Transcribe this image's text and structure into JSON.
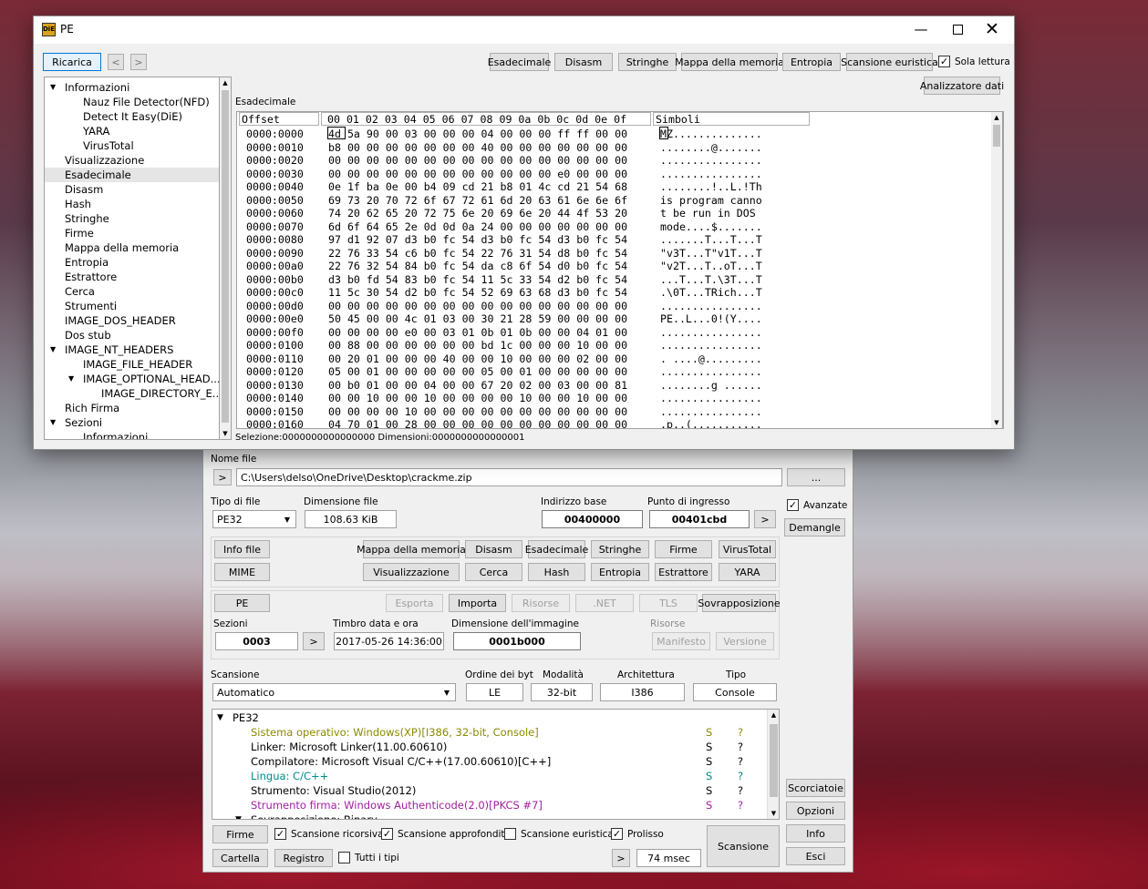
{
  "pe": {
    "title": "PE",
    "logo": "DiE",
    "reload": "Ricarica",
    "nav_back": "<",
    "nav_fwd": ">",
    "tools": [
      "Esadecimale",
      "Disasm",
      "Stringhe",
      "Mappa della memoria",
      "Entropia",
      "Scansione euristica"
    ],
    "readonly": "Sola lettura",
    "data_inspector": "Analizzatore dati",
    "hex_caption": "Esadecimale",
    "selection": "Selezione:0000000000000000 Dimensioni:0000000000000001",
    "tree": [
      {
        "label": "Informazioni",
        "level": 0,
        "arrow": "down"
      },
      {
        "label": "Nauz File Detector(NFD)",
        "level": 1
      },
      {
        "label": "Detect It Easy(DiE)",
        "level": 1
      },
      {
        "label": "YARA",
        "level": 1
      },
      {
        "label": "VirusTotal",
        "level": 1
      },
      {
        "label": "Visualizzazione",
        "level": 0
      },
      {
        "label": "Esadecimale",
        "level": 0,
        "selected": true
      },
      {
        "label": "Disasm",
        "level": 0
      },
      {
        "label": "Hash",
        "level": 0
      },
      {
        "label": "Stringhe",
        "level": 0
      },
      {
        "label": "Firme",
        "level": 0
      },
      {
        "label": "Mappa della memoria",
        "level": 0
      },
      {
        "label": "Entropia",
        "level": 0
      },
      {
        "label": "Estrattore",
        "level": 0
      },
      {
        "label": "Cerca",
        "level": 0
      },
      {
        "label": "Strumenti",
        "level": 0
      },
      {
        "label": "IMAGE_DOS_HEADER",
        "level": 0
      },
      {
        "label": "Dos stub",
        "level": 0
      },
      {
        "label": "IMAGE_NT_HEADERS",
        "level": 0,
        "arrow": "down"
      },
      {
        "label": "IMAGE_FILE_HEADER",
        "level": 1
      },
      {
        "label": "IMAGE_OPTIONAL_HEAD...",
        "level": 1,
        "arrow": "down"
      },
      {
        "label": "IMAGE_DIRECTORY_E...",
        "level": 2
      },
      {
        "label": "Rich Firma",
        "level": 0
      },
      {
        "label": "Sezioni",
        "level": 0,
        "arrow": "down"
      },
      {
        "label": "Informazioni",
        "level": 1
      }
    ],
    "hex": {
      "col_offset": "Offset",
      "col_bytes": "00 01 02 03 04 05 06 07 08 09 0a 0b 0c 0d 0e 0f",
      "col_symbols": "Simboli",
      "rows": [
        {
          "o": "0000:0000",
          "b": "4d 5a 90 00 03 00 00 00 04 00 00 00 ff ff 00 00",
          "s": "MZ.............."
        },
        {
          "o": "0000:0010",
          "b": "b8 00 00 00 00 00 00 00 40 00 00 00 00 00 00 00",
          "s": "........@......."
        },
        {
          "o": "0000:0020",
          "b": "00 00 00 00 00 00 00 00 00 00 00 00 00 00 00 00",
          "s": "................"
        },
        {
          "o": "0000:0030",
          "b": "00 00 00 00 00 00 00 00 00 00 00 00 e0 00 00 00",
          "s": "................"
        },
        {
          "o": "0000:0040",
          "b": "0e 1f ba 0e 00 b4 09 cd 21 b8 01 4c cd 21 54 68",
          "s": "........!..L.!Th"
        },
        {
          "o": "0000:0050",
          "b": "69 73 20 70 72 6f 67 72 61 6d 20 63 61 6e 6e 6f",
          "s": "is program canno"
        },
        {
          "o": "0000:0060",
          "b": "74 20 62 65 20 72 75 6e 20 69 6e 20 44 4f 53 20",
          "s": "t be run in DOS "
        },
        {
          "o": "0000:0070",
          "b": "6d 6f 64 65 2e 0d 0d 0a 24 00 00 00 00 00 00 00",
          "s": "mode....$......."
        },
        {
          "o": "0000:0080",
          "b": "97 d1 92 07 d3 b0 fc 54 d3 b0 fc 54 d3 b0 fc 54",
          "s": ".......T...T...T"
        },
        {
          "o": "0000:0090",
          "b": "22 76 33 54 c6 b0 fc 54 22 76 31 54 d8 b0 fc 54",
          "s": "\"v3T...T\"v1T...T"
        },
        {
          "o": "0000:00a0",
          "b": "22 76 32 54 84 b0 fc 54 da c8 6f 54 d0 b0 fc 54",
          "s": "\"v2T...T..oT...T"
        },
        {
          "o": "0000:00b0",
          "b": "d3 b0 fd 54 83 b0 fc 54 11 5c 33 54 d2 b0 fc 54",
          "s": "...T...T.\\3T...T"
        },
        {
          "o": "0000:00c0",
          "b": "11 5c 30 54 d2 b0 fc 54 52 69 63 68 d3 b0 fc 54",
          "s": ".\\0T...TRich...T"
        },
        {
          "o": "0000:00d0",
          "b": "00 00 00 00 00 00 00 00 00 00 00 00 00 00 00 00",
          "s": "................"
        },
        {
          "o": "0000:00e0",
          "b": "50 45 00 00 4c 01 03 00 30 21 28 59 00 00 00 00",
          "s": "PE..L...0!(Y...."
        },
        {
          "o": "0000:00f0",
          "b": "00 00 00 00 e0 00 03 01 0b 01 0b 00 00 04 01 00",
          "s": "................"
        },
        {
          "o": "0000:0100",
          "b": "00 88 00 00 00 00 00 00 bd 1c 00 00 00 10 00 00",
          "s": "................"
        },
        {
          "o": "0000:0110",
          "b": "00 20 01 00 00 00 40 00 00 10 00 00 00 02 00 00",
          "s": ". ....@........."
        },
        {
          "o": "0000:0120",
          "b": "05 00 01 00 00 00 00 00 05 00 01 00 00 00 00 00",
          "s": "................"
        },
        {
          "o": "0000:0130",
          "b": "00 b0 01 00 00 04 00 00 67 20 02 00 03 00 00 81",
          "s": "........g ......"
        },
        {
          "o": "0000:0140",
          "b": "00 00 10 00 00 10 00 00 00 00 10 00 00 10 00 00",
          "s": "................"
        },
        {
          "o": "0000:0150",
          "b": "00 00 00 00 10 00 00 00 00 00 00 00 00 00 00 00",
          "s": "................"
        },
        {
          "o": "0000:0160",
          "b": "04 70 01 00 28 00 00 00 00 00 00 00 00 00 00 00",
          "s": ".p..(..........."
        }
      ]
    }
  },
  "main": {
    "file_label": "Nome file",
    "file_path": "C:\\Users\\delso\\OneDrive\\Desktop\\crackme.zip",
    "browse": "...",
    "arrow": ">",
    "type_label": "Tipo di file",
    "type_value": "PE32",
    "size_label": "Dimensione file",
    "size_value": "108.63 KiB",
    "base_label": "Indirizzo base",
    "base_value": "00400000",
    "entry_label": "Punto di ingresso",
    "entry_value": "00401cbd",
    "advanced": "Avanzate",
    "demangle": "Demangle",
    "row1": [
      "Info file",
      "Mappa della memoria",
      "Disasm",
      "Esadecimale",
      "Stringhe",
      "Firme",
      "VirusTotal"
    ],
    "row2": [
      "MIME",
      "Visualizzazione",
      "Cerca",
      "Hash",
      "Entropia",
      "Estrattore",
      "YARA"
    ],
    "pe_btn": "PE",
    "row3": [
      "Esporta",
      "Importa",
      "Risorse",
      ".NET",
      "TLS",
      "Sovrapposizione"
    ],
    "sections_label": "Sezioni",
    "sections_value": "0003",
    "timestamp_label": "Timbro data e ora",
    "timestamp_value": "2017-05-26 14:36:00",
    "imgsize_label": "Dimensione dell'immagine",
    "imgsize_value": "0001b000",
    "resources_label": "Risorse",
    "manifest": "Manifesto",
    "version": "Versione",
    "scan_label": "Scansione",
    "scan_value": "Automatico",
    "endian_label": "Ordine dei byt",
    "endian_value": "LE",
    "mode_label": "Modalità",
    "mode_value": "32-bit",
    "arch_label": "Architettura",
    "arch_value": "I386",
    "kind_label": "Tipo",
    "kind_value": "Console",
    "results_root": "PE32",
    "results": [
      {
        "text": "Sistema operativo: Windows(XP)[I386, 32-bit, Console]",
        "color": "#8a8a00",
        "s": "S",
        "q": "?"
      },
      {
        "text": "Linker: Microsoft Linker(11.00.60610)",
        "color": "#000000",
        "s": "S",
        "q": "?"
      },
      {
        "text": "Compilatore: Microsoft Visual C/C++(17.00.60610)[C++]",
        "color": "#000000",
        "s": "S",
        "q": "?"
      },
      {
        "text": "Lingua: C/C++",
        "color": "#008b8b",
        "s": "S",
        "q": "?"
      },
      {
        "text": "Strumento: Visual Studio(2012)",
        "color": "#000000",
        "s": "S",
        "q": "?"
      },
      {
        "text": "Strumento firma: Windows Authenticode(2.0)[PKCS #7]",
        "color": "#a020a0",
        "s": "S",
        "q": "?"
      }
    ],
    "results_cut": "Sovrapposizione: Binary",
    "shortcuts": "Scorciatoie",
    "options": "Opzioni",
    "info": "Info",
    "exit": "Esci",
    "firme": "Firme",
    "cartella": "Cartella",
    "registro": "Registro",
    "recursive": "Scansione ricorsiva",
    "deep": "Scansione approfondita",
    "heuristic": "Scansione euristica",
    "verbose": "Prolisso",
    "alltypes": "Tutti i tipi",
    "time": "74 msec",
    "scan_btn": "Scansione"
  }
}
